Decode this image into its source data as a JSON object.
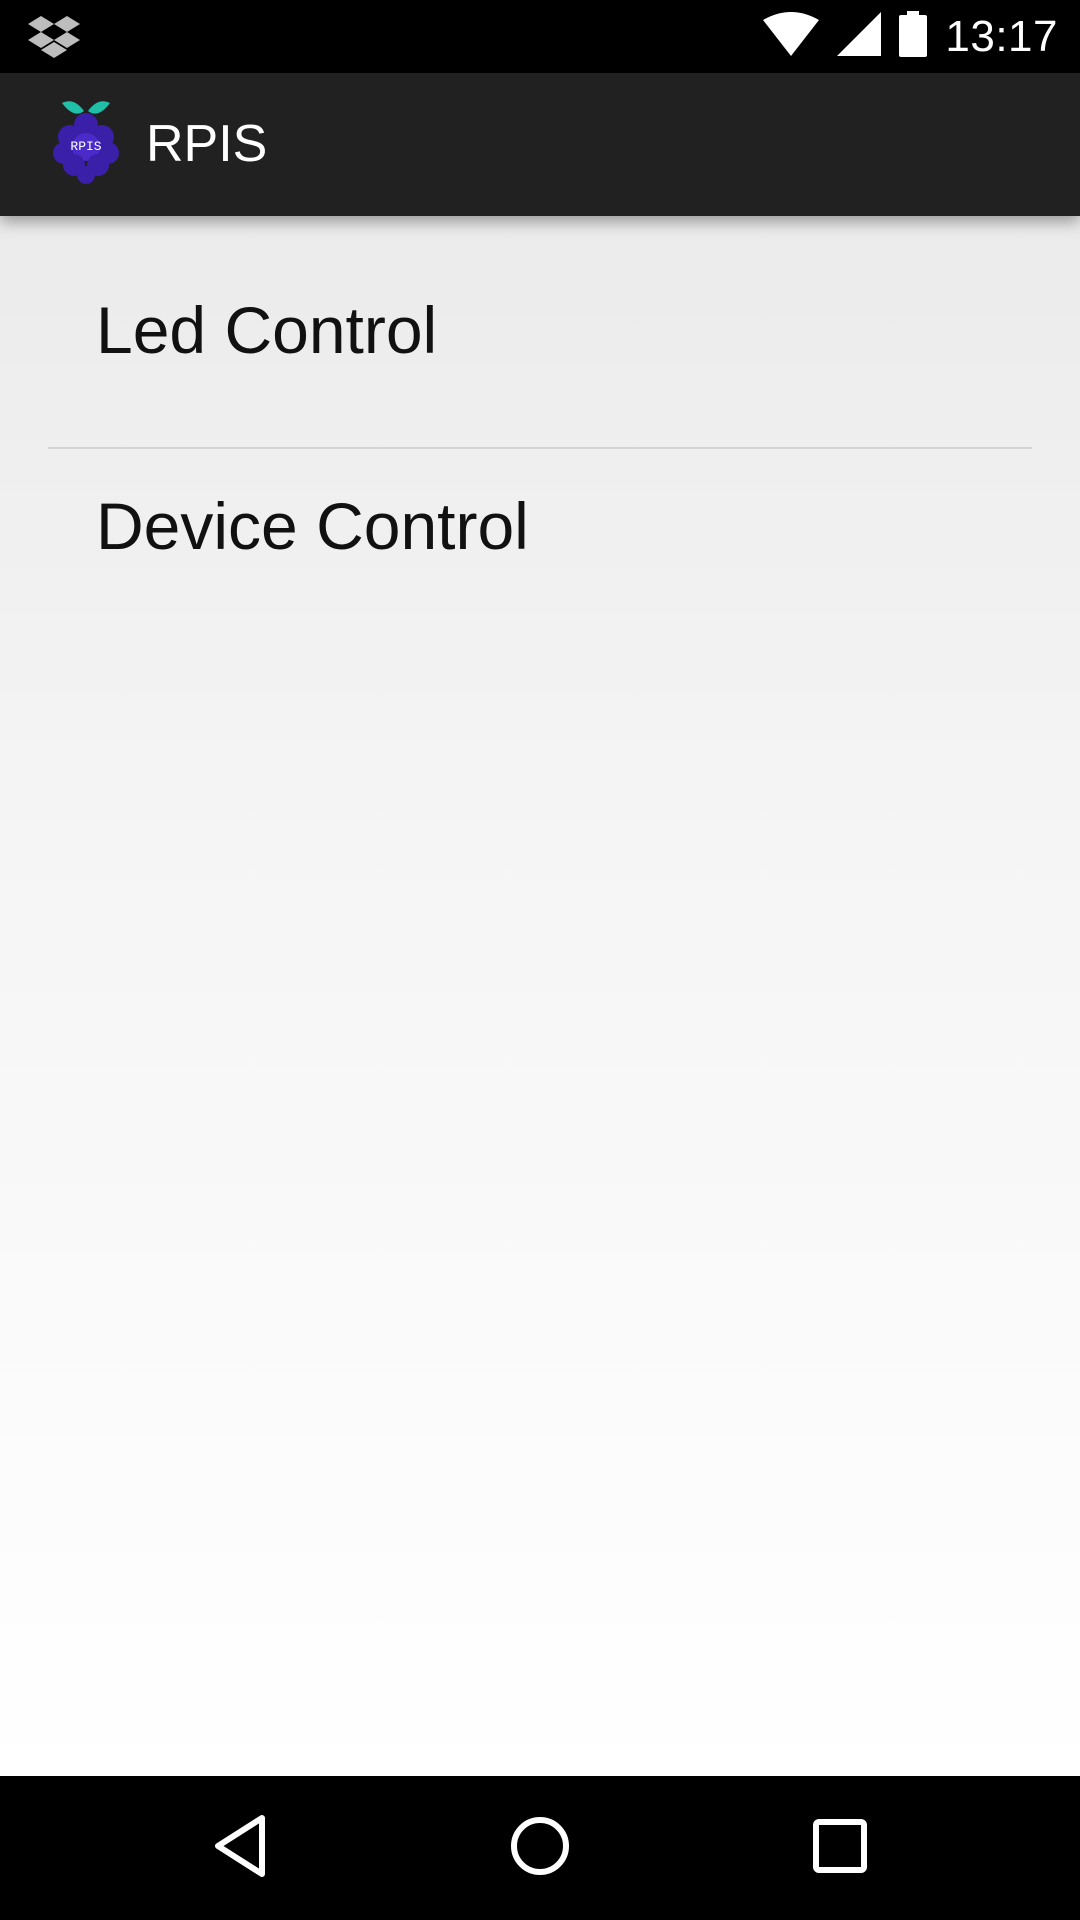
{
  "status_bar": {
    "time": "13:17",
    "icons": [
      "dropbox-icon",
      "wifi-icon",
      "cell-signal-icon",
      "battery-icon"
    ]
  },
  "app_bar": {
    "title": "RPIS",
    "logo_text": "RPIS",
    "background": "#212121"
  },
  "menu": {
    "items": [
      {
        "label": "Led Control"
      },
      {
        "label": "Device Control"
      }
    ]
  },
  "nav_bar": {
    "buttons": [
      "back-icon",
      "home-icon",
      "recents-icon"
    ]
  }
}
